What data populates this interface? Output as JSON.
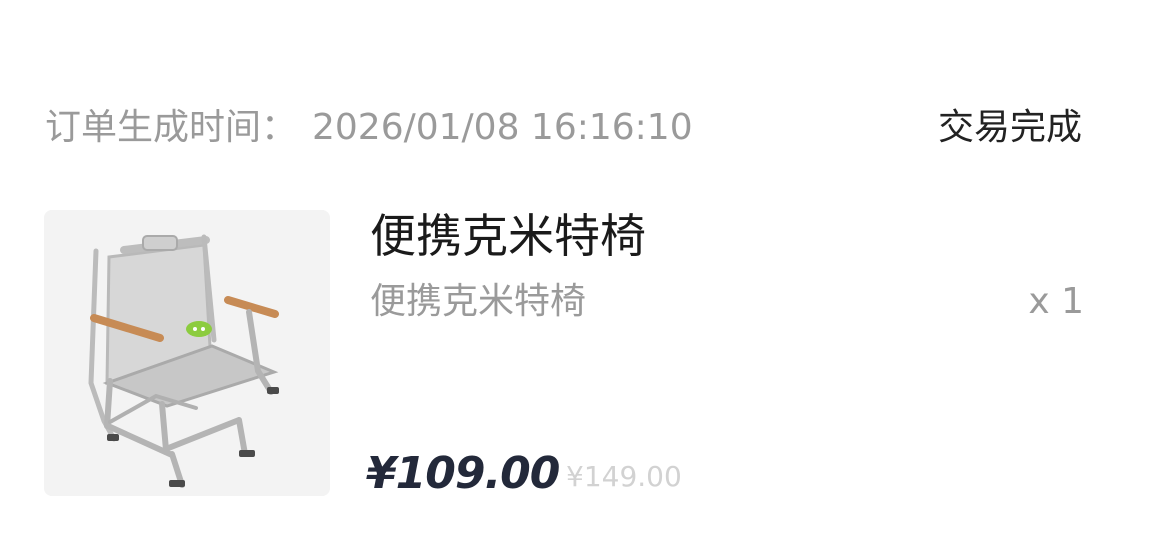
{
  "order": {
    "time_label": "订单生成时间：",
    "time_value": "2026/01/08 16:16:10",
    "status": "交易完成"
  },
  "product": {
    "image_icon": "camping-chair-photo",
    "title": "便携克米特椅",
    "spec": "便携克米特椅",
    "quantity": "x 1",
    "price": "¥109.00",
    "original_price": "¥149.00"
  },
  "colors": {
    "primary_text": "#1a1a1a",
    "secondary_text": "#9a9a9a",
    "price_text": "#23293a",
    "original_price_text": "#d2d2d2",
    "image_background": "#f3f3f3"
  }
}
